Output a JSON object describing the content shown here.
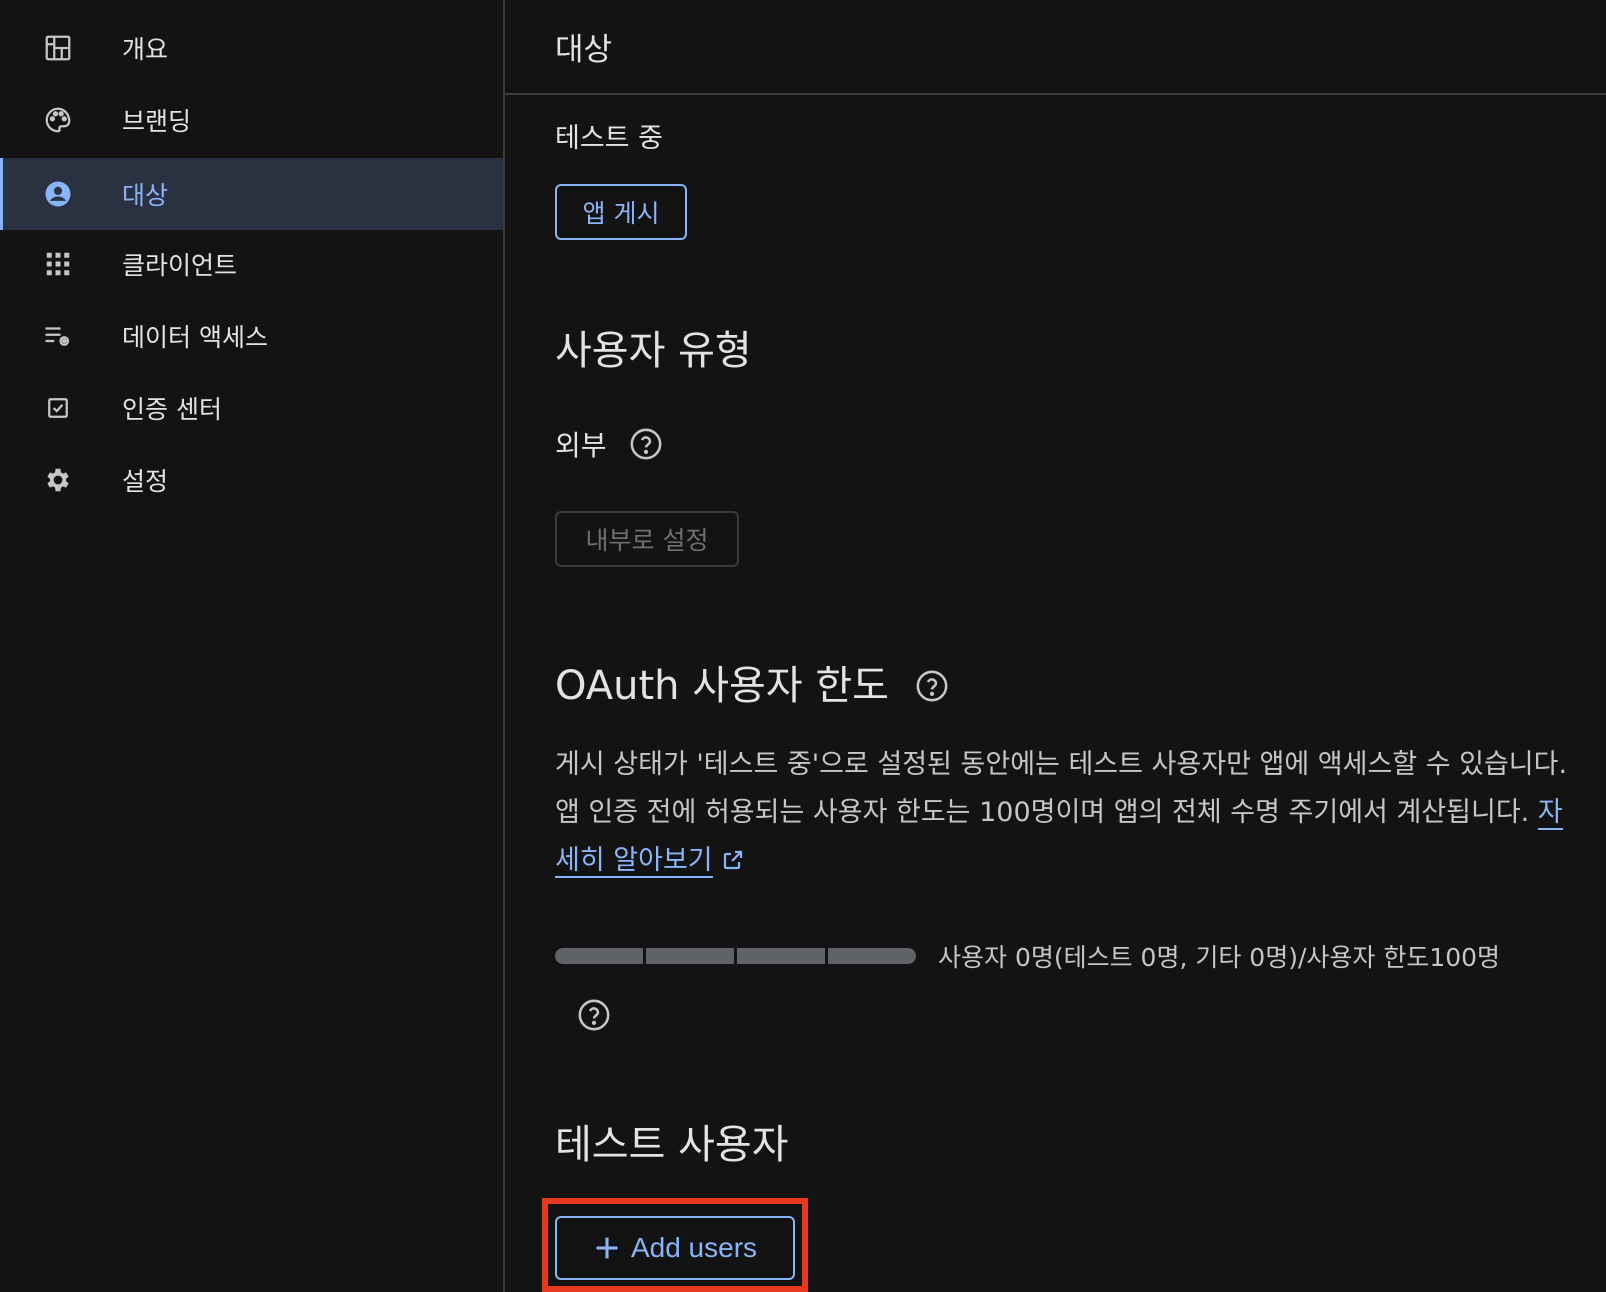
{
  "sidebar": {
    "items": [
      {
        "label": "개요",
        "icon": "dashboard-icon",
        "active": false
      },
      {
        "label": "브랜딩",
        "icon": "palette-icon",
        "active": false
      },
      {
        "label": "대상",
        "icon": "account-circle-icon",
        "active": true
      },
      {
        "label": "클라이언트",
        "icon": "apps-grid-icon",
        "active": false
      },
      {
        "label": "데이터 액세스",
        "icon": "data-settings-icon",
        "active": false
      },
      {
        "label": "인증 센터",
        "icon": "checkbox-icon",
        "active": false
      },
      {
        "label": "설정",
        "icon": "gear-icon",
        "active": false
      }
    ]
  },
  "header": {
    "title": "대상"
  },
  "publishing": {
    "status": "테스트 중",
    "publish_button": "앱 게시"
  },
  "user_type": {
    "title": "사용자 유형",
    "value": "외부",
    "make_internal_button": "내부로 설정"
  },
  "oauth_limit": {
    "title": "OAuth 사용자 한도",
    "description": "게시 상태가 '테스트 중'으로 설정된 동안에는 테스트 사용자만 앱에 액세스할 수 있습니다. 앱 인증 전에 허용되는 사용자 한도는 100명이며 앱의 전체 수명 주기에서 계산됩니다.",
    "learn_more": "자세히 알아보기",
    "quota_text": "사용자 0명(테스트 0명, 기타 0명)/사용자 한도100명",
    "quota_fraction": 0
  },
  "test_users": {
    "title": "테스트 사용자",
    "add_button": "Add users"
  },
  "colors": {
    "accent": "#8ab4f8",
    "background": "#131313",
    "active_nav_bg": "#2a3140",
    "highlight": "#e8391f"
  }
}
